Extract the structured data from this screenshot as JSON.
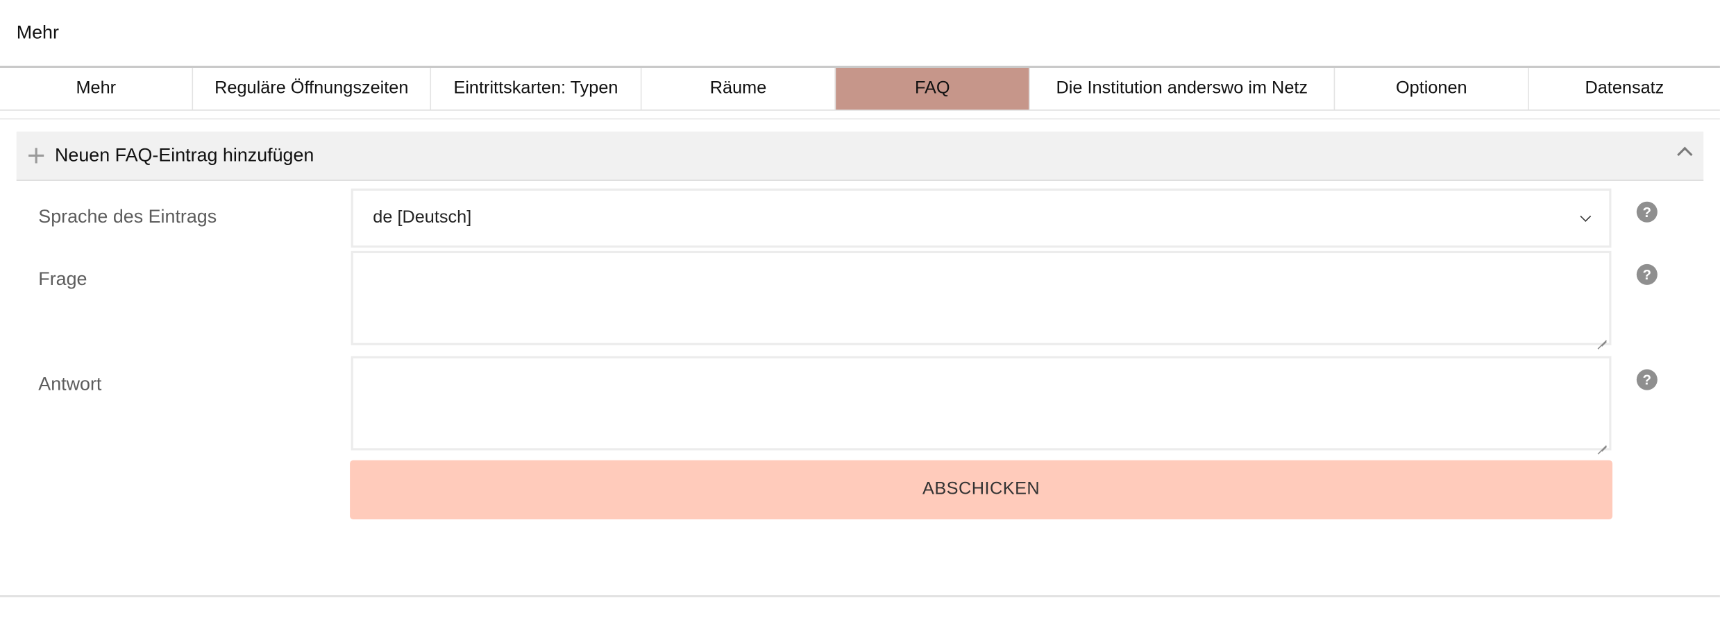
{
  "header": {
    "title": "Mehr"
  },
  "tabs": [
    {
      "label": "Mehr",
      "active": false
    },
    {
      "label": "Reguläre Öffnungszeiten",
      "active": false
    },
    {
      "label": "Eintrittskarten: Typen",
      "active": false
    },
    {
      "label": "Räume",
      "active": false
    },
    {
      "label": "FAQ",
      "active": true
    },
    {
      "label": "Die Institution anderswo im Netz",
      "active": false
    },
    {
      "label": "Optionen",
      "active": false
    },
    {
      "label": "Datensatz",
      "active": false
    }
  ],
  "section": {
    "title": "Neuen FAQ-Eintrag hinzufügen",
    "expand_icon": "plus-icon",
    "collapse_icon": "chevron-up-icon"
  },
  "form": {
    "language": {
      "label": "Sprache des Eintrags",
      "value": "de [Deutsch]"
    },
    "question": {
      "label": "Frage",
      "value": ""
    },
    "answer": {
      "label": "Antwort",
      "value": ""
    },
    "help_symbol": "?",
    "submit_label": "ABSCHICKEN"
  },
  "colors": {
    "active_tab": "#c6968a",
    "submit_button": "#ffcbbb",
    "section_bg": "#f1f1f1"
  }
}
